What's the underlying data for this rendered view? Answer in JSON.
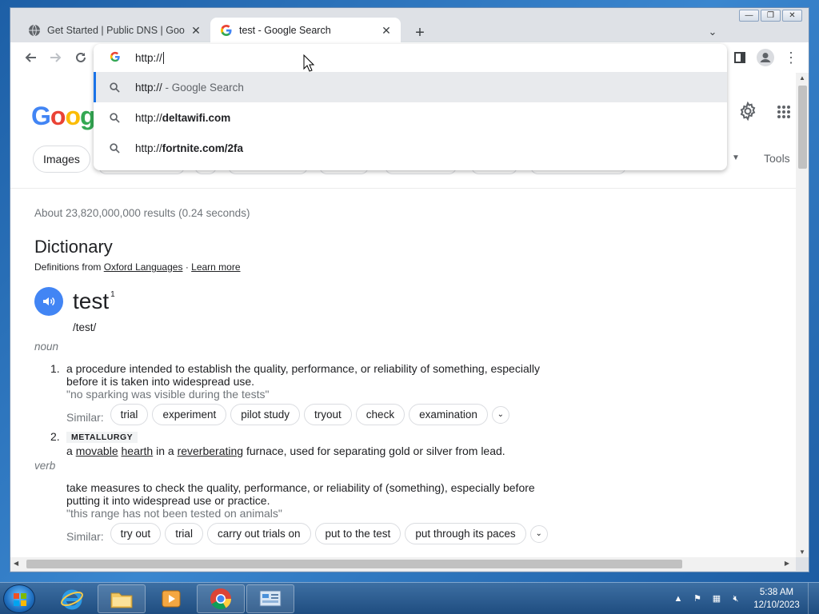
{
  "browser": {
    "tabs": [
      {
        "title": "Get Started  |  Public DNS  |  Goo",
        "active": false
      },
      {
        "title": "test - Google Search",
        "active": true
      }
    ],
    "new_tab": "+",
    "omnibox": {
      "value": "http://",
      "suggestions": [
        {
          "prefix": "http://",
          "bold": "",
          "suffix": " - Google Search",
          "selected": true
        },
        {
          "prefix": "http://",
          "bold": "deltawifi.com",
          "suffix": "",
          "selected": false
        },
        {
          "prefix": "http://",
          "bold": "fortnite.com/2fa",
          "suffix": "",
          "selected": false
        }
      ]
    }
  },
  "search": {
    "chip_images": "Images",
    "tools": "Tools",
    "result_stats": "About 23,820,000,000 results (0.24 seconds)"
  },
  "dictionary": {
    "title": "Dictionary",
    "source_prefix": "Definitions from",
    "source_link": "Oxford Languages",
    "source_sep": "·",
    "learn_more": "Learn more",
    "word": "test",
    "superscript": "1",
    "phonetic": "/test/",
    "noun_label": "noun",
    "verb_label": "verb",
    "similar_label": "Similar:",
    "noun_def1": {
      "number": "1.",
      "text": "a procedure intended to establish the quality, performance, or reliability of something, especially before it is taken into widespread use.",
      "example": "\"no sparking was visible during the tests\"",
      "similar": [
        "trial",
        "experiment",
        "pilot study",
        "tryout",
        "check",
        "examination"
      ]
    },
    "noun_def2": {
      "number": "2.",
      "tag": "METALLURGY",
      "text_a": "a ",
      "link1": "movable",
      "text_b": " ",
      "link2": "hearth",
      "text_c": " in a ",
      "link3": "reverberating",
      "text_d": " furnace, used for separating gold or silver from lead."
    },
    "verb_def": {
      "text": "take measures to check the quality, performance, or reliability of (something), especially before putting it into widespread use or practice.",
      "example": "\"this range has not been tested on animals\"",
      "similar": [
        "try out",
        "trial",
        "carry out trials on",
        "put to the test",
        "put through its paces"
      ]
    }
  },
  "taskbar": {
    "time": "5:38 AM",
    "date": "12/10/2023"
  },
  "colors": {
    "accent": "#1a73e8",
    "speaker": "#4285f4",
    "taskbar": "#2b5d92"
  }
}
